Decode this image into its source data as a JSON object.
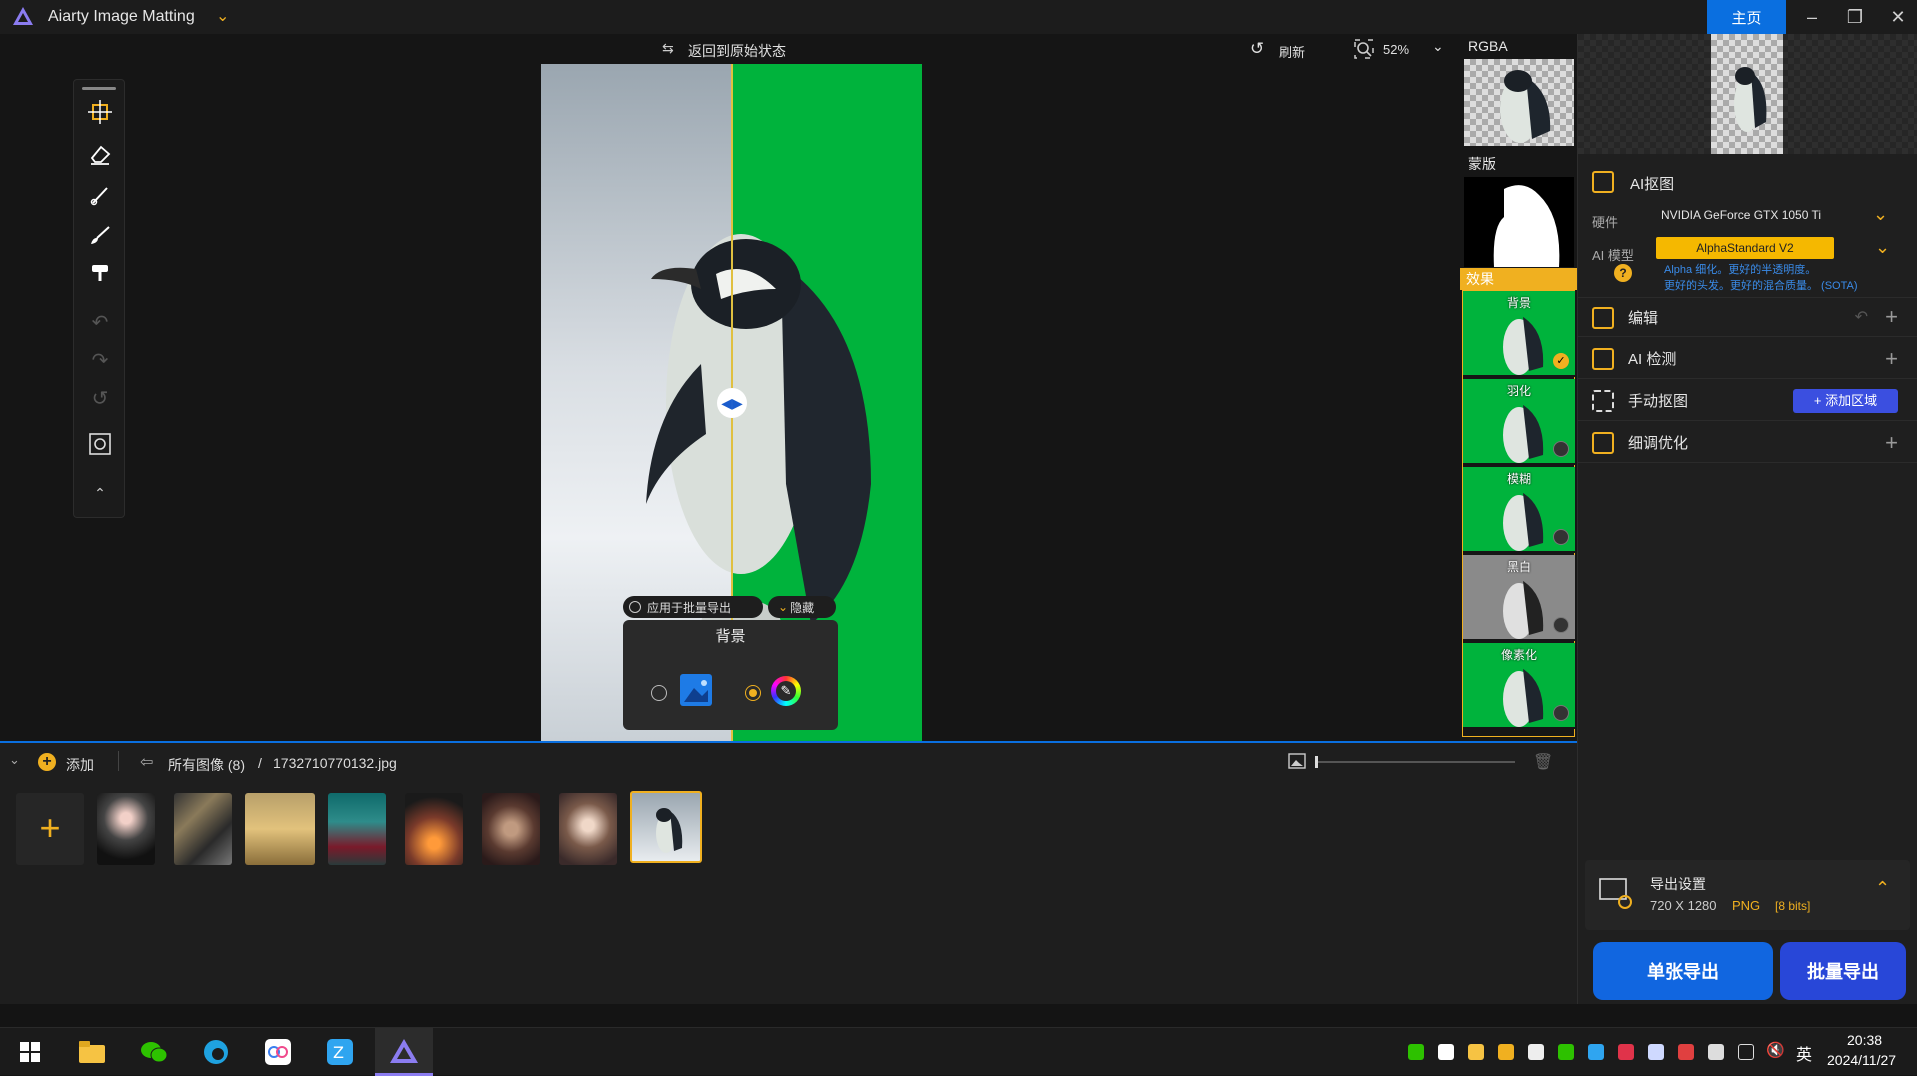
{
  "app": {
    "title": "Aiarty Image Matting",
    "home_label": "主页"
  },
  "toolbar": {
    "restore_label": "返回到原始状态",
    "refresh_label": "刷新",
    "zoom": "52%"
  },
  "canvas": {
    "batch_export_toggle": "应用于批量导出",
    "hide_label": "隐藏",
    "background_title": "背景"
  },
  "previews": {
    "rgba_label": "RGBA",
    "mask_label": "蒙版",
    "effect_label": "效果",
    "effects": [
      "背景",
      "羽化",
      "模糊",
      "黑白",
      "像素化"
    ]
  },
  "right_panel": {
    "ai_matting_title": "AI抠图",
    "hardware_label": "硬件",
    "hardware_value": "NVIDIA GeForce GTX 1050 Ti",
    "model_label": "AI 模型",
    "model_value": "AlphaStandard  V2",
    "model_desc_1": "Alpha 细化。更好的半透明度。",
    "model_desc_2": "更好的头发。更好的混合质量。 (SOTA)",
    "edit_title": "编辑",
    "detect_title": "AI 检测",
    "manual_title": "手动抠图",
    "add_region_label": "添加区域",
    "refine_title": "细调优化",
    "export_settings_title": "导出设置",
    "export_size": "720 X 1280",
    "export_format": "PNG",
    "export_bits": "[8 bits]",
    "single_export_label": "单张导出",
    "batch_export_label": "批量导出"
  },
  "filmstrip": {
    "add_label": "添加",
    "all_images_label": "所有图像 (8)",
    "separator": "/",
    "current_file": "1732710770132.jpg"
  },
  "taskbar": {
    "time": "20:38",
    "date": "2024/11/27",
    "ime": "英"
  },
  "colors": {
    "accent": "#f0b020",
    "primary_blue": "#1166e0",
    "green_bg": "#00b33c"
  }
}
